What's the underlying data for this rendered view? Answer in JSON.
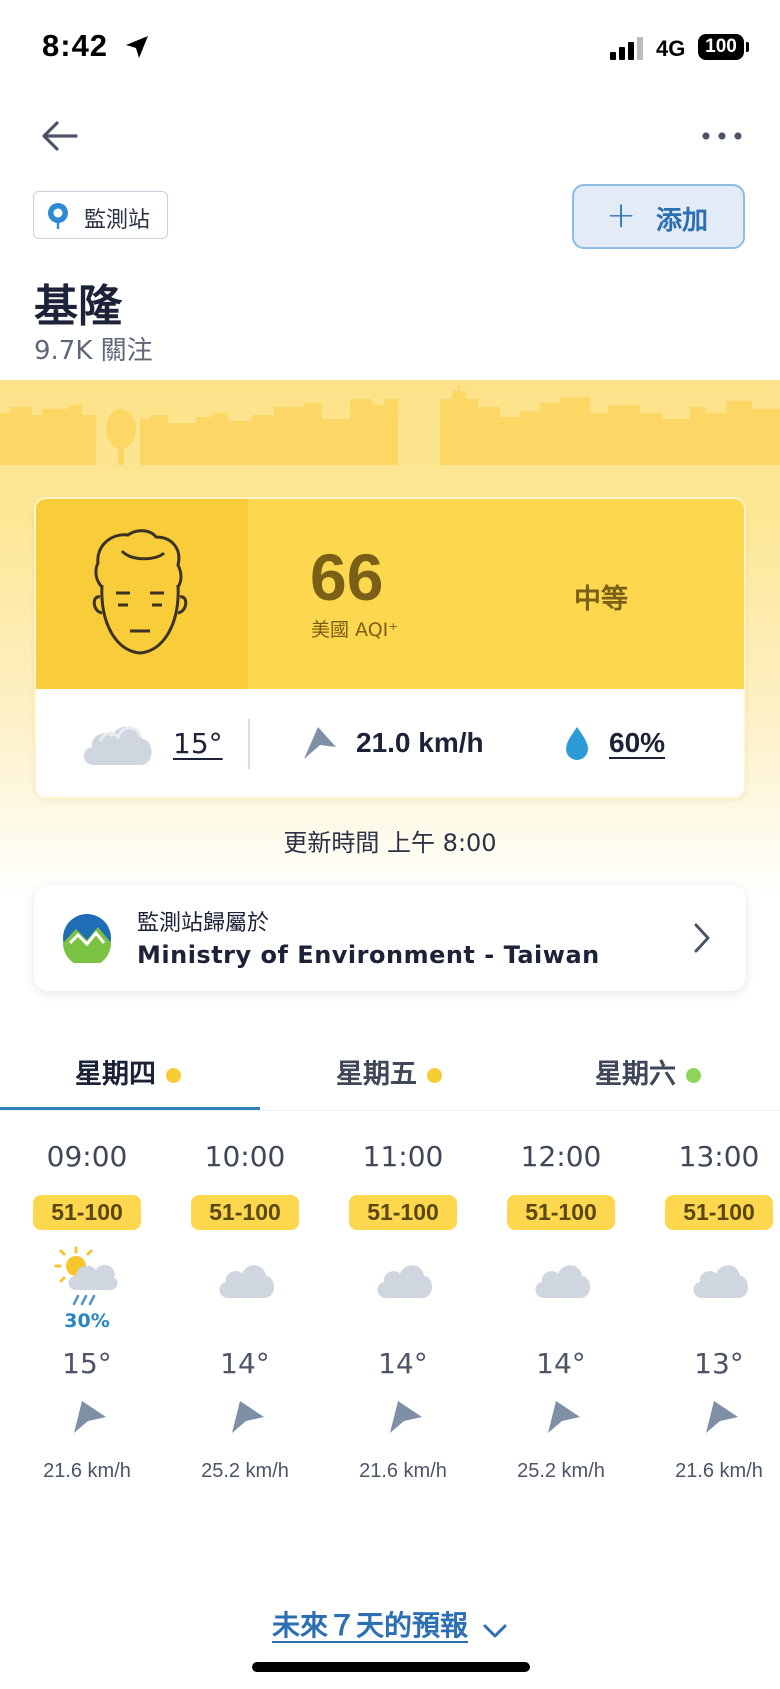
{
  "status_bar": {
    "time": "8:42",
    "network": "4G",
    "battery": "100"
  },
  "header": {
    "station_tag": "監測站",
    "add_label": "添加"
  },
  "location": {
    "city": "基隆",
    "followers": "9.7K 關注"
  },
  "aqi": {
    "value": "66",
    "label": "美國 AQI⁺",
    "level": "中等",
    "temperature": "15°",
    "wind": "21.0 km/h",
    "humidity": "60%",
    "color": "#fdd84f"
  },
  "updated": "更新時間 上午 8:00",
  "source": {
    "line1": "監測站歸屬於",
    "line2": "Ministry of Environment - Taiwan"
  },
  "days": [
    {
      "label": "星期四",
      "dot_color": "#f6cc35",
      "active": true
    },
    {
      "label": "星期五",
      "dot_color": "#f6cc35",
      "active": false
    },
    {
      "label": "星期六",
      "dot_color": "#8fd45b",
      "active": false
    }
  ],
  "hourly": [
    {
      "time": "09:00",
      "aqi": "51-100",
      "icon": "sun-cloud-rain-icon",
      "rain": "30%",
      "temp": "15°",
      "wind": "21.6 km/h"
    },
    {
      "time": "10:00",
      "aqi": "51-100",
      "icon": "cloud-icon",
      "rain": "",
      "temp": "14°",
      "wind": "25.2 km/h"
    },
    {
      "time": "11:00",
      "aqi": "51-100",
      "icon": "cloud-icon",
      "rain": "",
      "temp": "14°",
      "wind": "21.6 km/h"
    },
    {
      "time": "12:00",
      "aqi": "51-100",
      "icon": "cloud-icon",
      "rain": "",
      "temp": "14°",
      "wind": "25.2 km/h"
    },
    {
      "time": "13:00",
      "aqi": "51-100",
      "icon": "cloud-icon",
      "rain": "",
      "temp": "13°",
      "wind": "21.6 km/h"
    }
  ],
  "footer": {
    "forecast_link": "未來７天的預報"
  }
}
